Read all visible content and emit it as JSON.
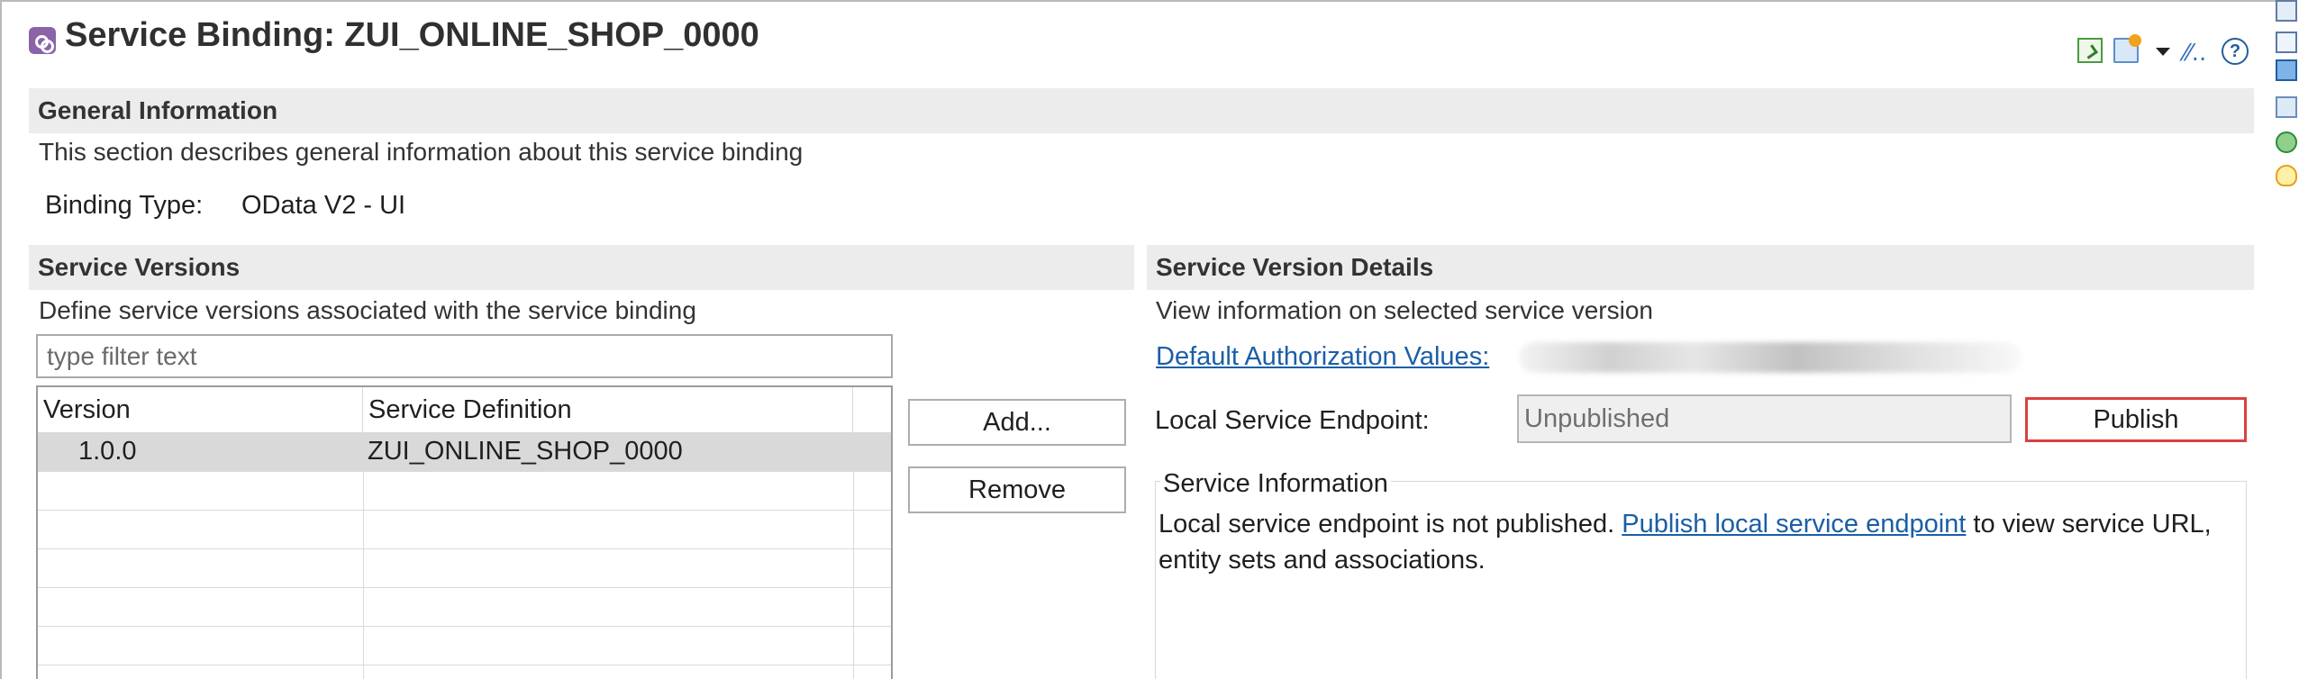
{
  "window": {
    "title": "Service Binding: ZUI_ONLINE_SHOP_0000"
  },
  "toolbar": {
    "icons": [
      "activate-doc-icon",
      "open-folder-icon",
      "dropdown-arrow-icon",
      "link-icon",
      "help-icon"
    ],
    "link_icon": "⁄⁄..",
    "help_icon": "?"
  },
  "general_information": {
    "heading": "General Information",
    "description": "This section describes general information about this service binding",
    "binding_type_label": "Binding Type:",
    "binding_type_value": "OData V2 - UI"
  },
  "service_versions": {
    "heading": "Service Versions",
    "description": "Define service versions associated with the service binding",
    "filter_placeholder": "type filter text",
    "columns": [
      "Version",
      "Service Definition"
    ],
    "rows": [
      {
        "version": "1.0.0",
        "service_definition": "ZUI_ONLINE_SHOP_0000"
      }
    ],
    "add_label": "Add...",
    "remove_label": "Remove"
  },
  "service_version_details": {
    "heading": "Service Version Details",
    "description": "View information on selected service version",
    "default_authorization_label": "Default Authorization Values:",
    "local_endpoint_label": "Local Service Endpoint:",
    "local_endpoint_value": "Unpublished",
    "publish_label": "Publish",
    "service_information_title": "Service Information",
    "service_information_text_1": "Local service endpoint is not published. ",
    "service_information_link": "Publish local service endpoint",
    "service_information_text_2": " to view service URL, entity sets and associations."
  },
  "side_rail_icons": [
    "outline-icon",
    "properties-icon",
    "book-icon",
    "transport-icon",
    "bug-icon",
    "lightbulb-icon"
  ],
  "colors": {
    "section_header_background": "#ececec",
    "selected_row_background": "#d9d9d9",
    "link": "#1a5ea8",
    "publish_highlight": "#d94141"
  }
}
